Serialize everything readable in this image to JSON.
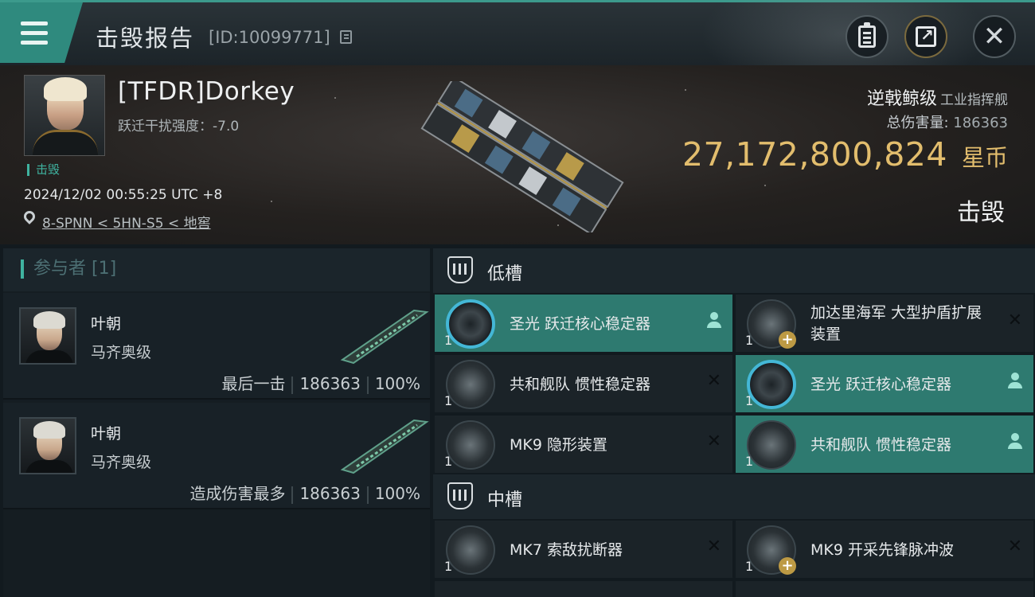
{
  "header": {
    "title": "击毁报告",
    "report_id": "[ID:10099771]",
    "icons": [
      "menu-icon",
      "copy-icon",
      "clipboard-icon",
      "share-icon",
      "close-icon"
    ]
  },
  "victim": {
    "pilot": "[TFDR]Dorkey",
    "security_status": "跃迁干扰强度：-7.0",
    "tag": "击毁",
    "datetime": "2024/12/02 00:55:25 UTC +8",
    "location": "8-SPNN < 5HN-S5 < 地窖",
    "ship_class": "逆戟鲸级",
    "ship_role": "工业指挥舰",
    "damage_label": "总伤害量:",
    "damage_value": "186363",
    "isk_amount": "27,172,800,824",
    "isk_unit": "星币",
    "status": "击毁"
  },
  "participants": {
    "title": "参与者 [1]",
    "cards": [
      {
        "name": "叶朝",
        "ship": "马齐奥级",
        "label": "最后一击",
        "damage": "186363",
        "percent": "100%"
      },
      {
        "name": "叶朝",
        "ship": "马齐奥级",
        "label": "造成伤害最多",
        "damage": "186363",
        "percent": "100%"
      }
    ]
  },
  "fitting": {
    "low_slots_label": "低槽",
    "mid_slots_label": "中槽",
    "low": [
      {
        "qty": "1",
        "name": "圣光 跃迁核心稳定器",
        "status": "user-icon"
      },
      {
        "qty": "1",
        "name": "加达里海军 大型护盾扩展装置",
        "status": "close-icon"
      },
      {
        "qty": "1",
        "name": "共和舰队 惯性稳定器",
        "status": "close-icon"
      },
      {
        "qty": "1",
        "name": "圣光 跃迁核心稳定器",
        "status": "user-icon"
      },
      {
        "qty": "1",
        "name": "MK9 隐形装置",
        "status": "close-icon"
      },
      {
        "qty": "1",
        "name": "共和舰队 惯性稳定器",
        "status": "user-icon"
      }
    ],
    "mid": [
      {
        "qty": "1",
        "name": "MK7 索敌扰断器",
        "status": "close-icon"
      },
      {
        "qty": "1",
        "name": "MK9 开采先锋脉冲波",
        "status": "close-icon"
      }
    ]
  },
  "colors": {
    "accent": "#3fb3a0",
    "highlight_slot": "#2e7a70",
    "isk_gold": "#e2bd6d",
    "panel_bg": "#151d22"
  }
}
